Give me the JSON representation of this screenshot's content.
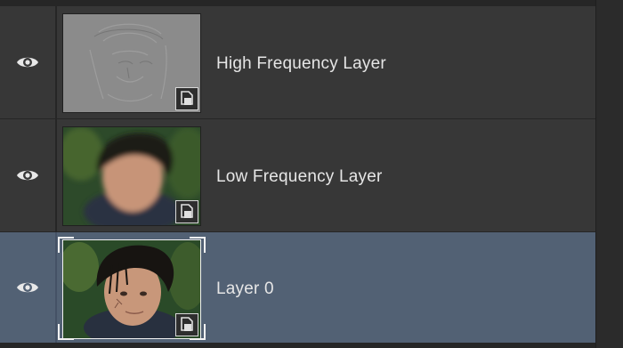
{
  "layers_panel": {
    "layers": [
      {
        "name": "High Frequency Layer",
        "visible": true,
        "selected": false,
        "thumbnail": "high-pass-gray-texture",
        "badge": "smart-object-icon"
      },
      {
        "name": "Low Frequency Layer",
        "visible": true,
        "selected": false,
        "thumbnail": "blurred-portrait",
        "badge": "smart-object-icon"
      },
      {
        "name": "Layer 0",
        "visible": true,
        "selected": true,
        "thumbnail": "sharp-portrait",
        "badge": "smart-object-icon"
      }
    ]
  },
  "colors": {
    "panel_bg": "#262626",
    "row_bg": "#373737",
    "selected_row_bg": "#526174",
    "text": "#e6e6e6"
  }
}
